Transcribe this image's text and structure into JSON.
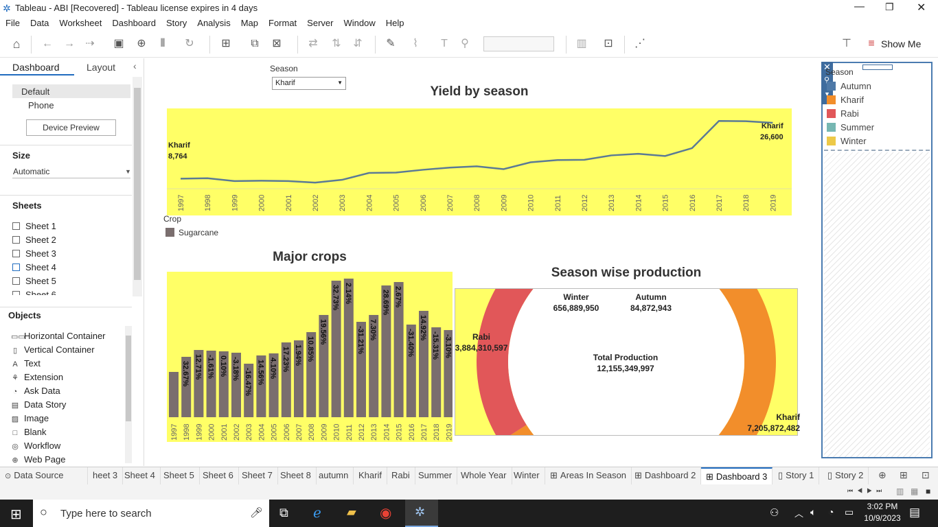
{
  "window": {
    "title": "Tableau - ABI [Recovered] - Tableau license expires in 4 days"
  },
  "menu": [
    "File",
    "Data",
    "Worksheet",
    "Dashboard",
    "Story",
    "Analysis",
    "Map",
    "Format",
    "Server",
    "Window",
    "Help"
  ],
  "toolbar": {
    "show_me": "Show Me"
  },
  "leftpane": {
    "tab_dashboard": "Dashboard",
    "tab_layout": "Layout",
    "default": "Default",
    "phone": "Phone",
    "device_preview": "Device Preview",
    "size_header": "Size",
    "size_value": "Automatic",
    "sheets_header": "Sheets",
    "sheets": [
      "Sheet 1",
      "Sheet 2",
      "Sheet 3",
      "Sheet 4",
      "Sheet 5",
      "Sheet 6"
    ],
    "objects_header": "Objects",
    "objects": [
      "Horizontal Container",
      "Vertical Container",
      "Text",
      "Extension",
      "Ask Data",
      "Data Story",
      "Image",
      "Blank",
      "Workflow",
      "Web Page"
    ]
  },
  "filter": {
    "label": "Season",
    "value": "Kharif"
  },
  "yield": {
    "title": "Yield by season",
    "start_label": "Kharif",
    "start_value": "8,764",
    "end_label": "Kharif",
    "end_value": "26,600"
  },
  "crop_legend": {
    "title": "Crop",
    "item": "Sugarcane",
    "color": "#7a6e6e"
  },
  "major": {
    "title": "Major crops"
  },
  "season_prod": {
    "title": "Season wise production",
    "winter_label": "Winter",
    "winter_value": "656,889,950",
    "autumn_label": "Autumn",
    "autumn_value": "84,872,943",
    "rabi_label": "Rabi",
    "rabi_value": "3,884,310,597",
    "kharif_label": "Kharif",
    "kharif_value": "7,205,872,482",
    "total_label": "Total Production",
    "total_value": "12,155,349,997"
  },
  "season_legend": {
    "title": "Season",
    "items": [
      {
        "name": "Autumn",
        "color": "#4e79a7"
      },
      {
        "name": "Kharif",
        "color": "#f28e2b"
      },
      {
        "name": "Rabi",
        "color": "#e15759"
      },
      {
        "name": "Summer",
        "color": "#76b7b2"
      },
      {
        "name": "Winter",
        "color": "#edc948"
      }
    ]
  },
  "tabs": [
    "Data Source",
    "heet 3",
    "Sheet 4",
    "Sheet 5",
    "Sheet 6",
    "Sheet 7",
    "Sheet 8",
    "autumn",
    "Kharif",
    "Rabi",
    "Summer",
    "Whole Year",
    "Winter",
    "Areas In Season",
    "Dashboard 2",
    "Dashboard 3",
    "Story 1",
    "Story 2"
  ],
  "taskbar": {
    "search_placeholder": "Type here to search",
    "time": "3:02 PM",
    "date": "10/9/2023"
  },
  "chart_data": [
    {
      "type": "line",
      "title": "Yield by season",
      "x": [
        "1997",
        "1998",
        "1999",
        "2000",
        "2001",
        "2002",
        "2003",
        "2004",
        "2005",
        "2006",
        "2007",
        "2008",
        "2009",
        "2010",
        "2011",
        "2012",
        "2013",
        "2014",
        "2015",
        "2016",
        "2017",
        "2018",
        "2019"
      ],
      "series": [
        {
          "name": "Kharif",
          "values": [
            8764,
            8900,
            8000,
            8100,
            8000,
            7500,
            8400,
            10600,
            10700,
            11600,
            12300,
            12700,
            11800,
            14000,
            14700,
            14800,
            16200,
            16700,
            16000,
            18500,
            27200,
            27100,
            26600
          ]
        }
      ],
      "color": "#5b7a95"
    },
    {
      "type": "bar",
      "title": "Major crops",
      "categories": [
        "1997",
        "1998",
        "1999",
        "2000",
        "2001",
        "2002",
        "2003",
        "2004",
        "2005",
        "2006",
        "2007",
        "2008",
        "2009",
        "2010",
        "2011",
        "2012",
        "2013",
        "2014",
        "2015",
        "2016",
        "2017",
        "2018",
        "2019"
      ],
      "series": [
        {
          "name": "Sugarcane",
          "values": [
            66,
            88,
            98,
            97,
            96,
            94,
            78,
            90,
            93,
            109,
            112,
            124,
            149,
            199,
            202,
            139,
            149,
            192,
            197,
            135,
            155,
            131,
            127
          ]
        }
      ],
      "data_labels": [
        "",
        "32.67%",
        "12.71%",
        "-1.61%",
        "0.10%",
        "-3.18%",
        "-16.47%",
        "14.56%",
        "4.10%",
        "17.23%",
        "1.94%",
        "10.85%",
        "19.56%",
        "32.73%",
        "2.14%",
        "-31.21%",
        "7.30%",
        "28.69%",
        "2.67%",
        "-31.40%",
        "14.92%",
        "-15.31%",
        "-3.10%"
      ],
      "color": "#7a6e6e"
    },
    {
      "type": "pie",
      "title": "Season wise production",
      "categories": [
        "Kharif",
        "Rabi",
        "Winter",
        "Autumn"
      ],
      "values": [
        7205872482,
        3884310597,
        656889950,
        84872943
      ],
      "total": 12155349997
    }
  ]
}
